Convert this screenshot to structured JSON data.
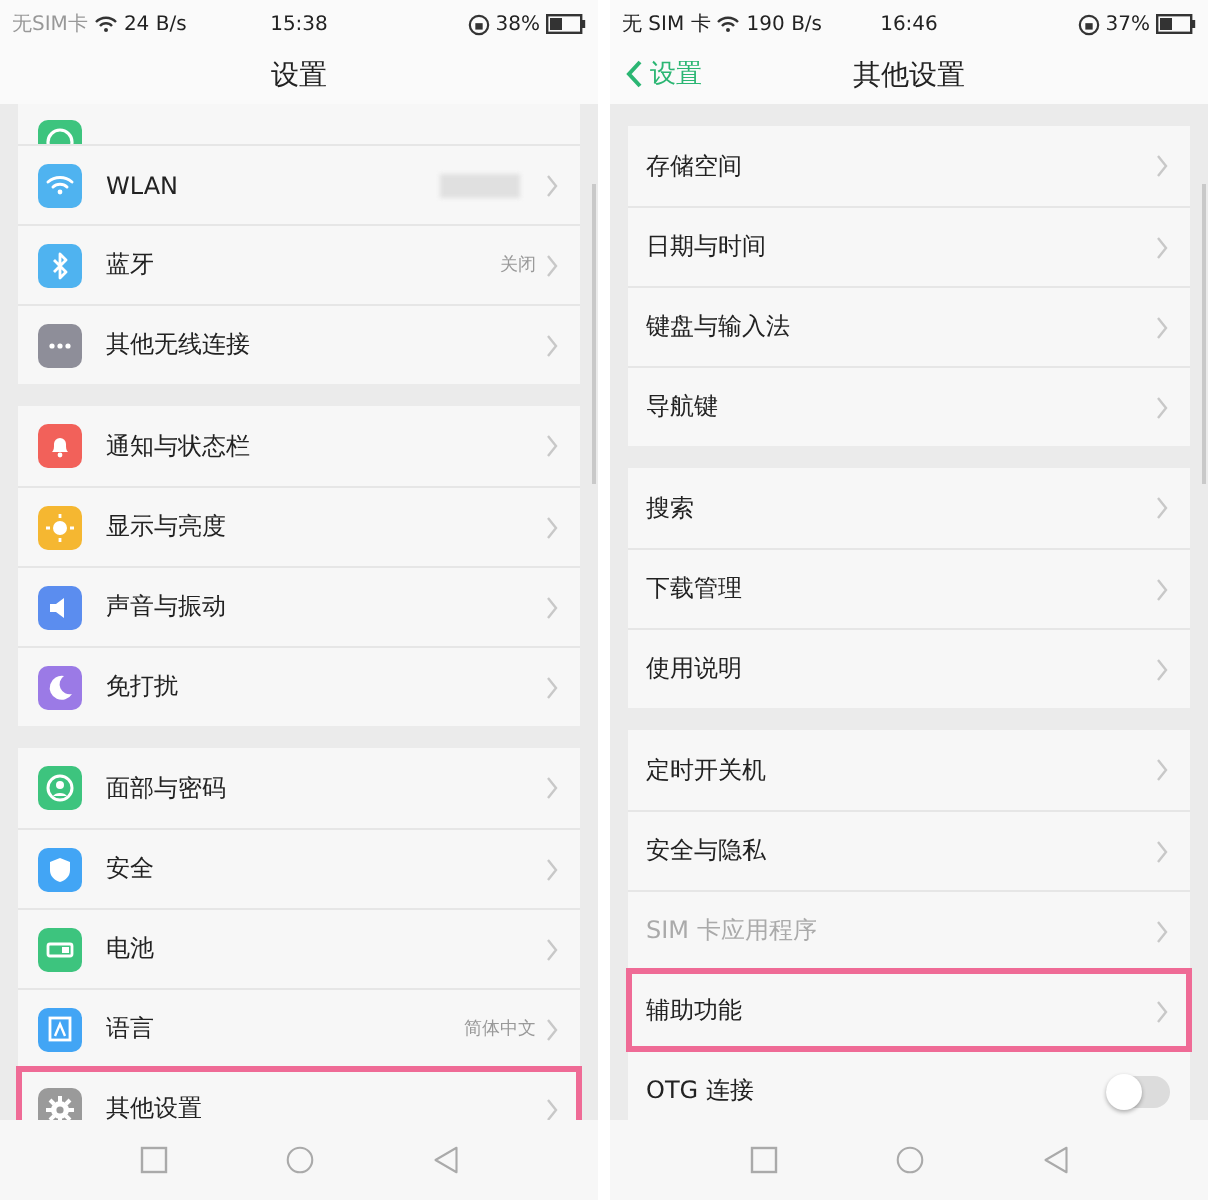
{
  "screens": [
    {
      "status_bar": {
        "carrier": "无SIM卡",
        "speed": "24 B/s",
        "time": "15:38",
        "battery": "38%"
      },
      "header": {
        "title": "设置"
      },
      "groups": [
        {
          "items": [
            {
              "kind": "partial",
              "color": "#3dc47e"
            },
            {
              "kind": "icon",
              "label": "WLAN",
              "color": "#4fb3f0",
              "redacted": true
            },
            {
              "kind": "icon",
              "label": "蓝牙",
              "color": "#4fb3f0",
              "value": "关闭"
            },
            {
              "kind": "icon",
              "label": "其他无线连接",
              "color": "#8e8e99"
            }
          ]
        },
        {
          "items": [
            {
              "kind": "icon",
              "label": "通知与状态栏",
              "color": "#f2615a"
            },
            {
              "kind": "icon",
              "label": "显示与亮度",
              "color": "#f5b731"
            },
            {
              "kind": "icon",
              "label": "声音与振动",
              "color": "#5b8def"
            },
            {
              "kind": "icon",
              "label": "免打扰",
              "color": "#9b7ae6"
            }
          ]
        },
        {
          "items": [
            {
              "kind": "icon",
              "label": "面部与密码",
              "color": "#3dc47e"
            },
            {
              "kind": "icon",
              "label": "安全",
              "color": "#42a5f5"
            },
            {
              "kind": "icon",
              "label": "电池",
              "color": "#3dc47e"
            },
            {
              "kind": "icon",
              "label": "语言",
              "color": "#42a5f5",
              "value": "简体中文"
            },
            {
              "kind": "icon",
              "label": "其他设置",
              "color": "#9a9a9a",
              "highlighted": true
            }
          ]
        }
      ]
    },
    {
      "status_bar": {
        "carrier": "无 SIM 卡",
        "speed": "190 B/s",
        "time": "16:46",
        "battery": "37%"
      },
      "header": {
        "back": "设置",
        "title": "其他设置"
      },
      "groups": [
        {
          "items": [
            {
              "kind": "plain",
              "label": "存储空间"
            },
            {
              "kind": "plain",
              "label": "日期与时间"
            },
            {
              "kind": "plain",
              "label": "键盘与输入法"
            },
            {
              "kind": "plain",
              "label": "导航键"
            }
          ]
        },
        {
          "items": [
            {
              "kind": "plain",
              "label": "搜索"
            },
            {
              "kind": "plain",
              "label": "下载管理"
            },
            {
              "kind": "plain",
              "label": "使用说明"
            }
          ]
        },
        {
          "items": [
            {
              "kind": "plain",
              "label": "定时开关机"
            },
            {
              "kind": "plain",
              "label": "安全与隐私"
            },
            {
              "kind": "plain",
              "label": "SIM 卡应用程序",
              "disabled": true
            },
            {
              "kind": "plain",
              "label": "辅助功能",
              "highlighted": true
            },
            {
              "kind": "toggle",
              "label": "OTG 连接",
              "on": false
            }
          ]
        }
      ]
    }
  ]
}
